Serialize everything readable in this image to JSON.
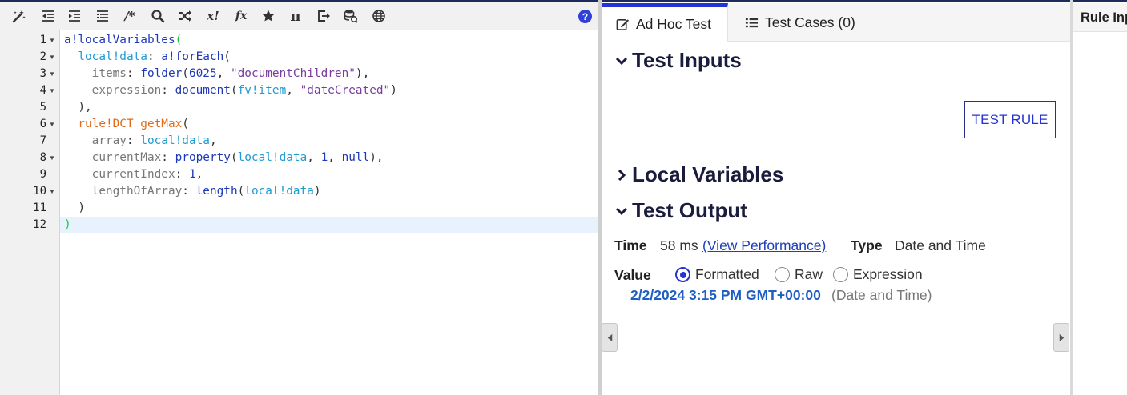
{
  "toolbar": {
    "icons": [
      "magic-wand-icon",
      "outdent-icon",
      "indent-icon",
      "list-icon",
      "comment-icon",
      "search-icon",
      "shuffle-icon",
      "x-factorial-icon",
      "function-icon",
      "star-icon",
      "pi-icon",
      "export-icon",
      "database-icon",
      "globe-icon"
    ],
    "comment_label": "/*",
    "x_label": "x!",
    "fx_label": "fx",
    "pi_label": "π",
    "help_label": "?"
  },
  "editor": {
    "line_numbers": [
      "1",
      "2",
      "3",
      "4",
      "5",
      "6",
      "7",
      "8",
      "9",
      "10",
      "11",
      "12"
    ],
    "fold_lines": [
      1,
      2,
      3,
      4,
      6,
      8,
      10
    ],
    "active_line": 12,
    "lines": [
      [
        {
          "t": "a!localVariables",
          "c": "fn"
        },
        {
          "t": "(",
          "c": "paren-hl"
        }
      ],
      [
        {
          "t": "  ",
          "c": "plain"
        },
        {
          "t": "local!data",
          "c": "var"
        },
        {
          "t": ": ",
          "c": "plain"
        },
        {
          "t": "a!forEach",
          "c": "fn"
        },
        {
          "t": "(",
          "c": "plain"
        }
      ],
      [
        {
          "t": "    ",
          "c": "plain"
        },
        {
          "t": "items",
          "c": "key"
        },
        {
          "t": ": ",
          "c": "plain"
        },
        {
          "t": "folder",
          "c": "fn"
        },
        {
          "t": "(",
          "c": "plain"
        },
        {
          "t": "6025",
          "c": "num"
        },
        {
          "t": ", ",
          "c": "plain"
        },
        {
          "t": "\"documentChildren\"",
          "c": "str"
        },
        {
          "t": "),",
          "c": "plain"
        }
      ],
      [
        {
          "t": "    ",
          "c": "plain"
        },
        {
          "t": "expression",
          "c": "key"
        },
        {
          "t": ": ",
          "c": "plain"
        },
        {
          "t": "document",
          "c": "fn"
        },
        {
          "t": "(",
          "c": "plain"
        },
        {
          "t": "fv!item",
          "c": "var"
        },
        {
          "t": ", ",
          "c": "plain"
        },
        {
          "t": "\"dateCreated\"",
          "c": "str"
        },
        {
          "t": ")",
          "c": "plain"
        }
      ],
      [
        {
          "t": "  ),",
          "c": "plain"
        }
      ],
      [
        {
          "t": "  ",
          "c": "plain"
        },
        {
          "t": "rule!DCT_getMax",
          "c": "rule"
        },
        {
          "t": "(",
          "c": "plain"
        }
      ],
      [
        {
          "t": "    ",
          "c": "plain"
        },
        {
          "t": "array",
          "c": "key"
        },
        {
          "t": ": ",
          "c": "plain"
        },
        {
          "t": "local!data",
          "c": "var"
        },
        {
          "t": ",",
          "c": "plain"
        }
      ],
      [
        {
          "t": "    ",
          "c": "plain"
        },
        {
          "t": "currentMax",
          "c": "key"
        },
        {
          "t": ": ",
          "c": "plain"
        },
        {
          "t": "property",
          "c": "fn"
        },
        {
          "t": "(",
          "c": "plain"
        },
        {
          "t": "local!data",
          "c": "var"
        },
        {
          "t": ", ",
          "c": "plain"
        },
        {
          "t": "1",
          "c": "num"
        },
        {
          "t": ", ",
          "c": "plain"
        },
        {
          "t": "null",
          "c": "fn"
        },
        {
          "t": "),",
          "c": "plain"
        }
      ],
      [
        {
          "t": "    ",
          "c": "plain"
        },
        {
          "t": "currentIndex",
          "c": "key"
        },
        {
          "t": ": ",
          "c": "plain"
        },
        {
          "t": "1",
          "c": "num"
        },
        {
          "t": ",",
          "c": "plain"
        }
      ],
      [
        {
          "t": "    ",
          "c": "plain"
        },
        {
          "t": "lengthOfArray",
          "c": "key"
        },
        {
          "t": ": ",
          "c": "plain"
        },
        {
          "t": "length",
          "c": "fn"
        },
        {
          "t": "(",
          "c": "plain"
        },
        {
          "t": "local!data",
          "c": "var"
        },
        {
          "t": ")",
          "c": "plain"
        }
      ],
      [
        {
          "t": "  )",
          "c": "plain"
        }
      ],
      [
        {
          "t": ")",
          "c": "paren-hl"
        }
      ]
    ]
  },
  "tabs": {
    "ad_hoc": "Ad Hoc Test",
    "test_cases": "Test Cases (0)"
  },
  "sections": {
    "test_inputs": "Test Inputs",
    "local_variables": "Local Variables",
    "test_output": "Test Output"
  },
  "test_rule_button": "TEST RULE",
  "output": {
    "time_label": "Time",
    "time_value": "58 ms",
    "view_performance": "(View Performance)",
    "type_label": "Type",
    "type_value": "Date and Time",
    "value_label": "Value",
    "formats": [
      {
        "label": "Formatted",
        "selected": true
      },
      {
        "label": "Raw",
        "selected": false
      },
      {
        "label": "Expression",
        "selected": false
      }
    ],
    "result": "2/2/2024 3:15 PM GMT+00:00",
    "result_type": "(Date and Time)"
  },
  "rule_inputs_tab": "Rule Inputs",
  "colors": {
    "accent": "#2432d6",
    "heading": "#1a1c3d",
    "result": "#1f5fc4"
  }
}
